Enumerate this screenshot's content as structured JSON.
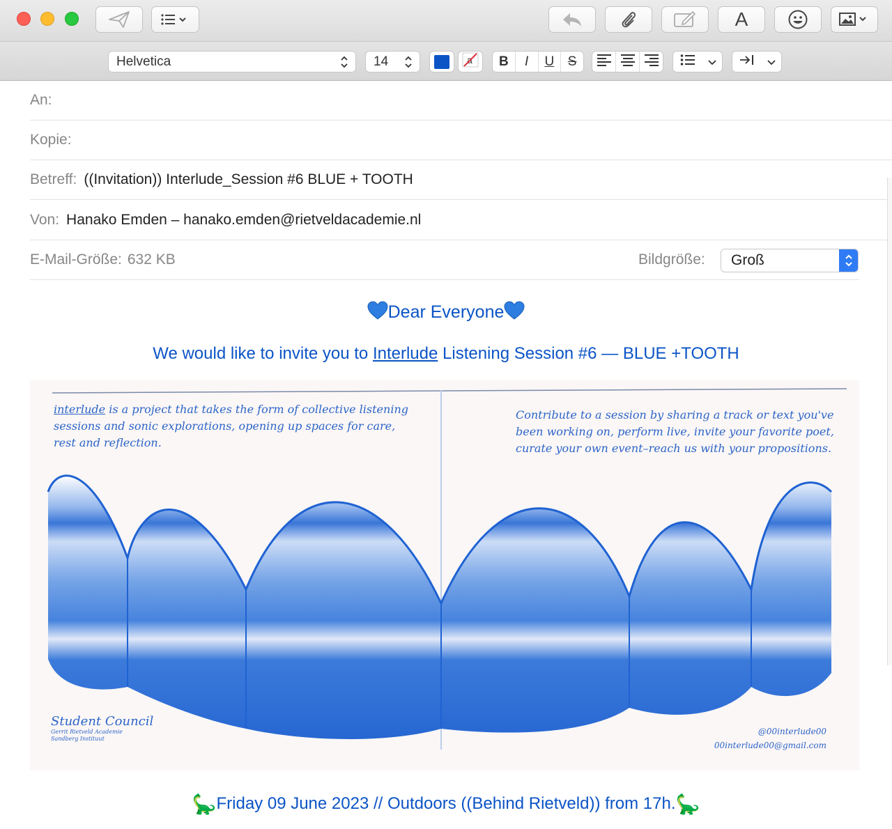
{
  "toolbar": {
    "send_icon": "paper-plane-icon",
    "header_fields_icon": "list-icon",
    "reply_icon": "reply-icon",
    "attach_icon": "paperclip-icon",
    "markup_icon": "markup-icon",
    "format_label": "A",
    "emoji_icon": "smiley-icon",
    "photo_icon": "photo-browser-icon"
  },
  "format": {
    "font": "Helvetica",
    "size": "14",
    "text_color": "#0b54c6",
    "bold": "B",
    "italic": "I",
    "underline": "U",
    "strike": "S"
  },
  "fields": {
    "to_label": "An:",
    "cc_label": "Kopie:",
    "subject_label": "Betreff:",
    "subject_value": "((Invitation)) Interlude_Session #6 BLUE + TOOTH",
    "from_label": "Von:",
    "from_value": "Hanako Emden – hanako.emden@rietveldacademie.nl",
    "size_label": "E-Mail-Größe:",
    "size_value": "632 KB",
    "image_size_label": "Bildgröße:",
    "image_size_value": "Groß"
  },
  "body": {
    "greeting": "Dear Everyone",
    "invite_pre": "We would like to invite you to ",
    "invite_link": "Interlude",
    "invite_post": " Listening Session #6 — BLUE +TOOTH",
    "flyer_left_word": "interlude",
    "flyer_left_text": " is a project that takes the form of collective listening sessions and sonic explorations, opening up spaces for care, rest and reflection.",
    "flyer_right_text": "Contribute to a session by sharing a track or text you've been working on, perform live, invite your favorite poet, curate your own event–reach us with your propositions.",
    "flyer_council": "Student Council",
    "flyer_council_sub1": "Gerrit Rietveld Academie",
    "flyer_council_sub2": "Sandberg Instituut",
    "flyer_insta": "@00interlude00",
    "flyer_email": "00interlude00@gmail.com",
    "event_line": "Friday 09 June 2023 // Outdoors ((Behind Rietveld)) from 17h.",
    "dino": "🦕"
  },
  "colors": {
    "accent": "#0b54c6",
    "select_blue": "#2f7bf5"
  }
}
